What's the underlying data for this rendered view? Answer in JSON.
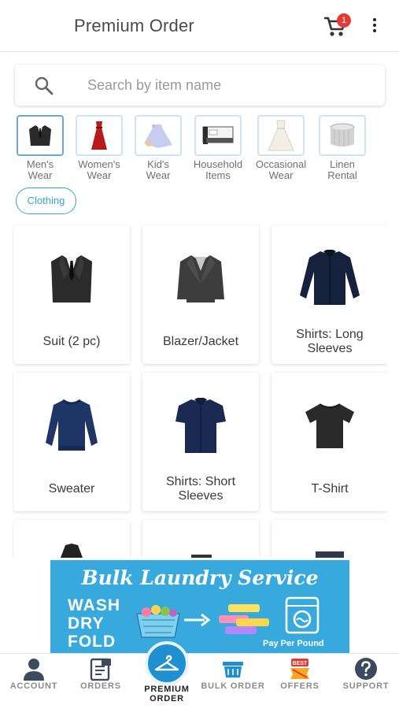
{
  "header": {
    "title": "Premium Order",
    "cart_count": "1"
  },
  "search": {
    "placeholder": "Search by item name"
  },
  "categories": [
    {
      "line1": "Men's",
      "line2": "Wear",
      "icon": "suit-thumb"
    },
    {
      "line1": "Women's",
      "line2": "Wear",
      "icon": "dress-thumb"
    },
    {
      "line1": "Kid's",
      "line2": "Wear",
      "icon": "kids-dress-thumb"
    },
    {
      "line1": "Household",
      "line2": "Items",
      "icon": "bedding-thumb"
    },
    {
      "line1": "Occasional",
      "line2": "Wear",
      "icon": "gown-thumb"
    },
    {
      "line1": "Linen",
      "line2": "Rental",
      "icon": "table-linen-thumb"
    }
  ],
  "filter_chip": "Clothing",
  "items": [
    {
      "name": "Suit (2 pc)",
      "icon": "suit-icon"
    },
    {
      "name": "Blazer/Jacket",
      "icon": "blazer-icon"
    },
    {
      "name": "Shirts: Long Sleeves",
      "icon": "long-sleeve-shirt-icon"
    },
    {
      "name": "Sweater",
      "icon": "sweater-icon"
    },
    {
      "name": "Shirts: Short Sleeves",
      "icon": "short-sleeve-shirt-icon"
    },
    {
      "name": "T-Shirt",
      "icon": "tshirt-icon"
    }
  ],
  "banner": {
    "title": "Bulk Laundry Service",
    "line1": "WASH",
    "line2": "DRY",
    "line3": "FOLD",
    "tagline": "Pay Per Pound",
    "best_badge": "BEST"
  },
  "nav": [
    {
      "label": "ACCOUNT",
      "icon": "account-icon"
    },
    {
      "label": "ORDERS",
      "icon": "orders-icon"
    },
    {
      "label": "PREMIUM ORDER",
      "icon": "hanger-icon"
    },
    {
      "label": "BULK ORDER",
      "icon": "laundry-basket-icon"
    },
    {
      "label": "OFFERS",
      "icon": "offers-icon"
    },
    {
      "label": "SUPPORT",
      "icon": "help-icon"
    }
  ],
  "colors": {
    "accent": "#1f8fd0",
    "chip": "#3ea0d2",
    "badge": "#e53935",
    "banner": "#38a9dd"
  }
}
